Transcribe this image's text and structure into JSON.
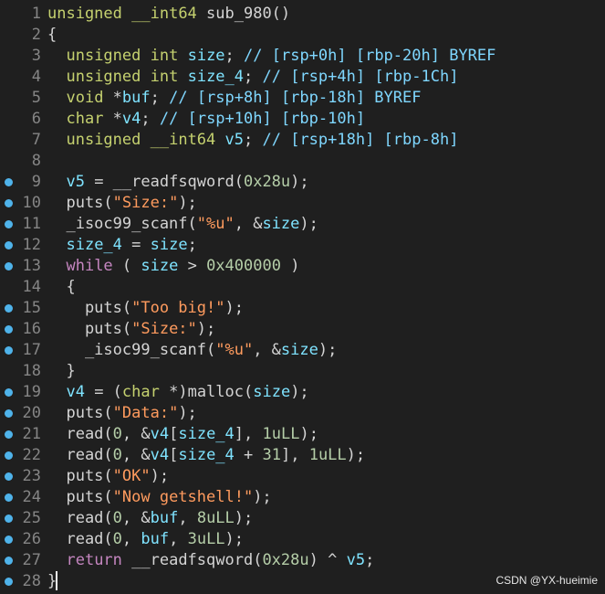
{
  "watermark": "CSDN @YX-hueimie",
  "code_lines": [
    {
      "n": "1",
      "dot": false,
      "text": "unsigned __int64 sub_980()"
    },
    {
      "n": "2",
      "dot": false,
      "text": "{"
    },
    {
      "n": "3",
      "dot": false,
      "text": "  unsigned int size; // [rsp+0h] [rbp-20h] BYREF"
    },
    {
      "n": "4",
      "dot": false,
      "text": "  unsigned int size_4; // [rsp+4h] [rbp-1Ch]"
    },
    {
      "n": "5",
      "dot": false,
      "text": "  void *buf; // [rsp+8h] [rbp-18h] BYREF"
    },
    {
      "n": "6",
      "dot": false,
      "text": "  char *v4; // [rsp+10h] [rbp-10h]"
    },
    {
      "n": "7",
      "dot": false,
      "text": "  unsigned __int64 v5; // [rsp+18h] [rbp-8h]"
    },
    {
      "n": "8",
      "dot": false,
      "text": ""
    },
    {
      "n": "9",
      "dot": true,
      "text": "  v5 = __readfsqword(0x28u);"
    },
    {
      "n": "10",
      "dot": true,
      "text": "  puts(\"Size:\");"
    },
    {
      "n": "11",
      "dot": true,
      "text": "  _isoc99_scanf(\"%u\", &size);"
    },
    {
      "n": "12",
      "dot": true,
      "text": "  size_4 = size;"
    },
    {
      "n": "13",
      "dot": true,
      "text": "  while ( size > 0x400000 )"
    },
    {
      "n": "14",
      "dot": false,
      "text": "  {"
    },
    {
      "n": "15",
      "dot": true,
      "text": "    puts(\"Too big!\");"
    },
    {
      "n": "16",
      "dot": true,
      "text": "    puts(\"Size:\");"
    },
    {
      "n": "17",
      "dot": true,
      "text": "    _isoc99_scanf(\"%u\", &size);"
    },
    {
      "n": "18",
      "dot": false,
      "text": "  }"
    },
    {
      "n": "19",
      "dot": true,
      "text": "  v4 = (char *)malloc(size);"
    },
    {
      "n": "20",
      "dot": true,
      "text": "  puts(\"Data:\");"
    },
    {
      "n": "21",
      "dot": true,
      "text": "  read(0, &v4[size_4], 1uLL);"
    },
    {
      "n": "22",
      "dot": true,
      "text": "  read(0, &v4[size_4 + 31], 1uLL);"
    },
    {
      "n": "23",
      "dot": true,
      "text": "  puts(\"OK\");"
    },
    {
      "n": "24",
      "dot": true,
      "text": "  puts(\"Now getshell!\");"
    },
    {
      "n": "25",
      "dot": true,
      "text": "  read(0, &buf, 8uLL);"
    },
    {
      "n": "26",
      "dot": true,
      "text": "  read(0, buf, 3uLL);"
    },
    {
      "n": "27",
      "dot": true,
      "text": "  return __readfsqword(0x28u) ^ v5;"
    },
    {
      "n": "28",
      "dot": true,
      "text": "}"
    }
  ]
}
